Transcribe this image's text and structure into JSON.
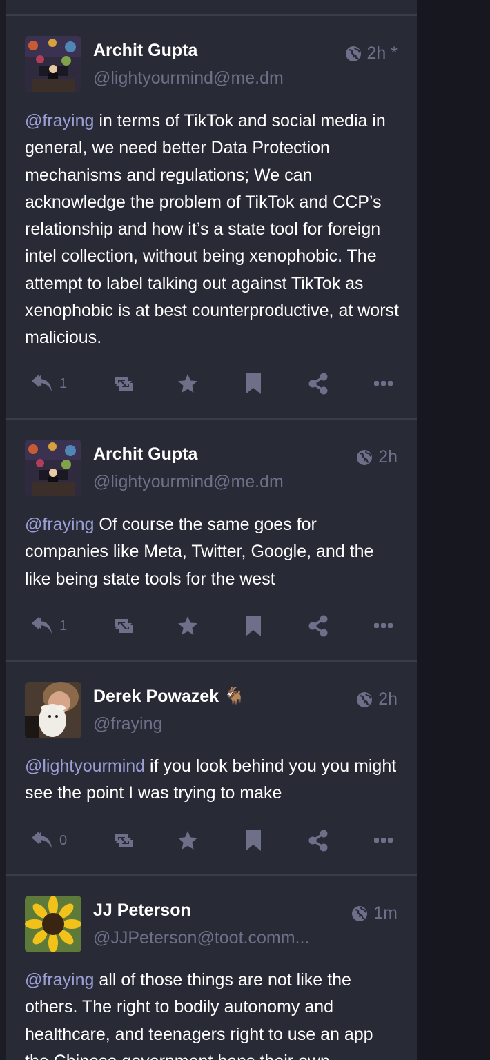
{
  "colors": {
    "background": "#282a36",
    "text": "#ffffff",
    "muted": "#6d7088",
    "mention": "#9c9fd6",
    "divider": "#3a3c4a"
  },
  "statuses": [
    {
      "name": "Archit Gupta",
      "handle": "@lightyourmind@me.dm",
      "time": "2h *",
      "mention": "@fraying",
      "text": " in terms of TikTok and social media in general, we need better Data Protection mechanisms and regulations; We can acknowledge the problem of TikTok and CCP’s relationship and how it’s a state tool for foreign intel collection, without being xenophobic. The attempt to label talking out against TikTok as xenophobic is at best counterproductive, at worst malicious.",
      "reply_count": "1"
    },
    {
      "name": "Archit Gupta",
      "handle": "@lightyourmind@me.dm",
      "time": "2h",
      "mention": "@fraying",
      "text": " Of course the same goes for companies like Meta, Twitter, Google, and the like being state tools for the west",
      "reply_count": "1"
    },
    {
      "name": "Derek Powazek",
      "name_emoji": "🐐",
      "handle": "@fraying",
      "time": "2h",
      "mention": "@lightyourmind",
      "text": " if you look behind you you might see the point I was trying to make",
      "reply_count": "0"
    },
    {
      "name": "JJ Peterson",
      "handle": "@JJPeterson@toot.comm...",
      "time": "1m",
      "mention": "@fraying",
      "text": " all of those things are not like the others. The right to bodily autonomy and healthcare, and teenagers right to use an app the Chinese government bans their own"
    }
  ],
  "icons": {
    "visibility": "globe-icon",
    "reply": "reply-icon",
    "boost": "boost-icon",
    "favourite": "star-icon",
    "bookmark": "bookmark-icon",
    "share": "share-icon",
    "more": "more-icon"
  }
}
